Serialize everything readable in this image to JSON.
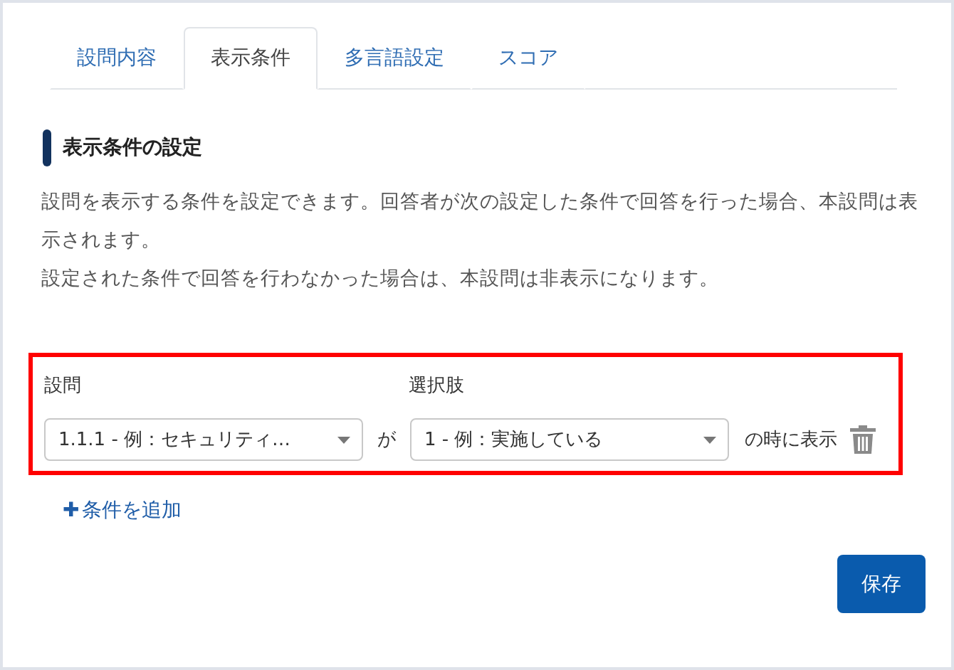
{
  "tabs": [
    {
      "label": "設問内容",
      "selected": false
    },
    {
      "label": "表示条件",
      "selected": true
    },
    {
      "label": "多言語設定",
      "selected": false
    },
    {
      "label": "スコア",
      "selected": false
    }
  ],
  "section": {
    "title": "表示条件の設定",
    "description": [
      "設問を表示する条件を設定できます。回答者が次の設定した条件で回答を行った場合、本設問は表示されます。",
      "設定された条件で回答を行わなかった場合は、本設問は非表示になります。"
    ]
  },
  "conditions": {
    "question_label": "設問",
    "choice_label": "選択肢",
    "rows": [
      {
        "question": "1.1.1 - 例：セキュリティ…",
        "connector": "が",
        "choice": "1 - 例：実施している",
        "suffix": "の時に表示"
      }
    ]
  },
  "add_condition": {
    "icon": "✚",
    "label": "条件を追加"
  },
  "save_button": "保存"
}
